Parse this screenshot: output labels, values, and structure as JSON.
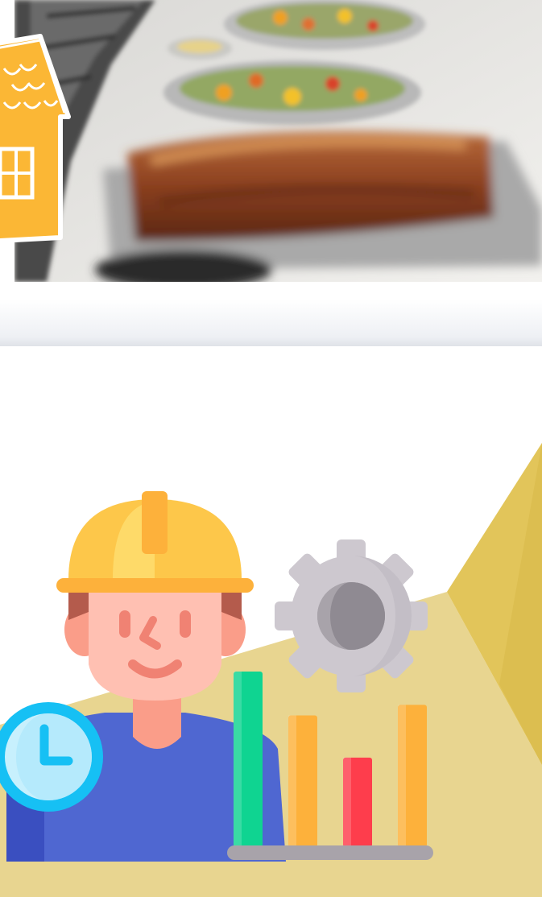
{
  "hero": {
    "icon": "food-platter-photo",
    "logo_icon": "house-logo-icon"
  },
  "illustration": {
    "worker_icon": "construction-worker-icon",
    "helmet_icon": "hard-hat-icon",
    "gear_icon": "gear-icon",
    "clock_icon": "clock-icon",
    "bar_chart_icon": "bar-chart-icon",
    "colors": {
      "background_shape": "#e8d28a",
      "helmet": "#fdc74a",
      "shirt": "#4f67d1",
      "gear": "#cdc8cf",
      "clock": "#16c0f4",
      "bar_green": "#0fd491",
      "bar_orange": "#fdb13b",
      "bar_red": "#fe3d4c"
    },
    "bars": [
      {
        "name": "bar-1",
        "value": 100,
        "color": "#0fd491"
      },
      {
        "name": "bar-2",
        "value": 75,
        "color": "#fdb13b"
      },
      {
        "name": "bar-3",
        "value": 51,
        "color": "#fe3d4c"
      },
      {
        "name": "bar-4",
        "value": 81,
        "color": "#fdb13b"
      }
    ]
  }
}
